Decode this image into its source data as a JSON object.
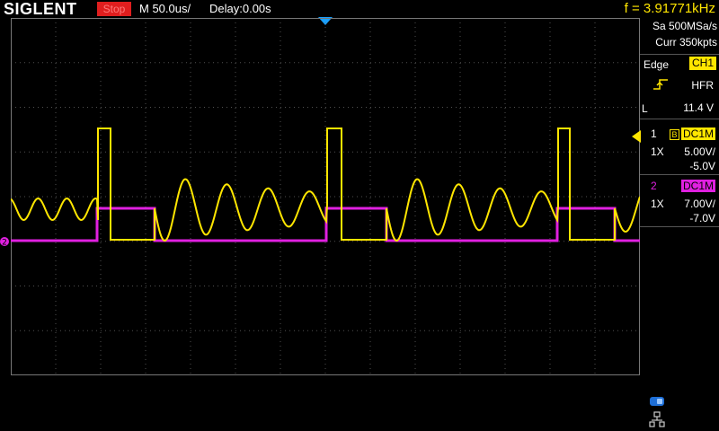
{
  "brand": "SIGLENT",
  "status": "Stop",
  "timebase": "M 50.0us/",
  "delay": "Delay:0.00s",
  "frequency": "f = 3.91771kHz",
  "acquisition": {
    "sample_rate": "Sa 500MSa/s",
    "curr_points": "Curr 350kpts"
  },
  "trigger": {
    "type": "Edge",
    "source": "CH1",
    "slope_icon": "rising-edge-icon",
    "coupling": "HFR",
    "level_marker": "L",
    "level": "11.4 V"
  },
  "channels": [
    {
      "num": "1",
      "bw_badge": "B",
      "coupling": "DC1M",
      "probe": "1X",
      "scale": "5.00V/",
      "offset": "-5.0V",
      "color": "#ffe600"
    },
    {
      "num": "2",
      "coupling": "DC1M",
      "probe": "1X",
      "scale": "7.00V/",
      "offset": "-7.0V",
      "color": "#e020e0"
    }
  ],
  "markers": {
    "ch2_ground": "2"
  },
  "icons": {
    "usb": "usb-icon",
    "network": "network-icon"
  },
  "colors": {
    "ch1": "#ffe600",
    "ch2": "#e020e0",
    "trigger_marker": "#19a0ff",
    "status_bg": "#e01e1e"
  }
}
